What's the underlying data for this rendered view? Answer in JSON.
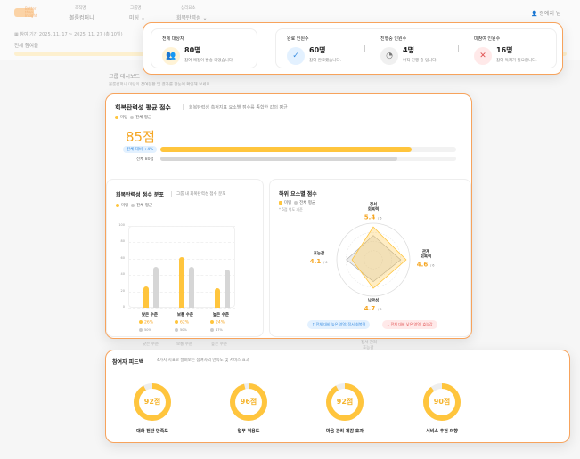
{
  "header": {
    "logo": "Better than Insight",
    "org_label": "조직명",
    "org_value": "볼룸컴퍼니",
    "group_label": "그룹명",
    "group_value": "미팅",
    "factor_label": "심리요소",
    "factor_value": "회복탄력성",
    "user": "장예지 님"
  },
  "period": "참여 기간 2025. 11. 17 ~ 2025. 11. 27 (총 10일)",
  "participation_label": "전체 참여율",
  "participation_rate": 0.75,
  "dashboard": {
    "title": "그룹 대시보드",
    "subtitle": "볼룸컴퍼니 미팅의 참여현황 및 결과를 한눈에 확인해 보세요."
  },
  "stats": {
    "total": {
      "label": "전체 대상자",
      "value": "80명",
      "desc": "참여 예정이 발송 되었습니다."
    },
    "done": {
      "label": "완료 인원수",
      "value": "60명",
      "desc": "참여 완료했습니다."
    },
    "progress": {
      "label": "진행중 인원수",
      "value": "4명",
      "desc": "아직 진행 중 입니다."
    },
    "none": {
      "label": "미참여 인원수",
      "value": "16명",
      "desc": "참여 독려가 필요합니다."
    }
  },
  "avg": {
    "title": "회복탄력성 평균 점수",
    "desc": "회복탄력성 측정지표 요소별 점수를 종합한 값의 평균",
    "legend_group": "미팅",
    "legend_all": "전체 평균",
    "score": "85점",
    "badge": "전체 대비 +4%",
    "all_label": "전체 80점",
    "group_value": 85,
    "all_value": 80
  },
  "dist": {
    "title": "회복탄력성 점수 분포",
    "desc": "그룹 내 회복탄력성 점수 분포",
    "legend_group": "미팅",
    "legend_all": "전체 평균",
    "yticks": [
      "100",
      "80",
      "60",
      "40",
      "20",
      "0"
    ],
    "categories": [
      {
        "label": "낮은 수준",
        "group": 26,
        "all": 50,
        "group_pct": "26%",
        "all_pct": "50%"
      },
      {
        "label": "보통 수준",
        "group": 62,
        "all": 50,
        "group_pct": "62%",
        "all_pct": "50%"
      },
      {
        "label": "높은 수준",
        "group": 24,
        "all": 47,
        "group_pct": "24%",
        "all_pct": "47%"
      }
    ]
  },
  "radar": {
    "title": "하위 요소별 점수",
    "legend_group": "미팅",
    "legend_all": "전체 평균",
    "note": "* 6점 척도 기준",
    "max": "/ 6",
    "axes": [
      {
        "label1": "정서",
        "label2": "회복력",
        "value": "5.4",
        "g": 5.4,
        "a": 4.0
      },
      {
        "label1": "관계",
        "label2": "회복력",
        "value": "4.6",
        "g": 5.4,
        "a": 4.5
      },
      {
        "label1": "낙관성",
        "label2": "",
        "value": "4.7",
        "g": 4.7,
        "a": 3.6
      },
      {
        "label1": "효능감",
        "label2": "",
        "value": "4.1",
        "g": 3.5,
        "a": 4.4
      }
    ],
    "high": "↑ 전체 대비 높은 영역: 정서 회복력",
    "low": "↓ 전체 대비 낮은 영역: 효능감"
  },
  "ghost": {
    "l1": "낮은 수준",
    "l2": "보통 수준",
    "l3": "높은 수준",
    "r1": "정서 관리",
    "r2": "효능감"
  },
  "feedback": {
    "title": "참여자 피드백",
    "desc": "4가지 지표로 살펴보는 참여자의 만족도 및 서비스 효과",
    "items": [
      {
        "score": "92점",
        "value": 92,
        "label": "대화 전반 만족도"
      },
      {
        "score": "96점",
        "value": 96,
        "label": "업무 적용도"
      },
      {
        "score": "92점",
        "value": 92,
        "label": "마음 관리 체감 효과"
      },
      {
        "score": "90점",
        "value": 90,
        "label": "서비스 추천 의향"
      }
    ]
  },
  "colors": {
    "accent": "#f5a623",
    "bar": "#ffc53d",
    "gray": "#d6d6d6",
    "border": "#f7a35c"
  }
}
